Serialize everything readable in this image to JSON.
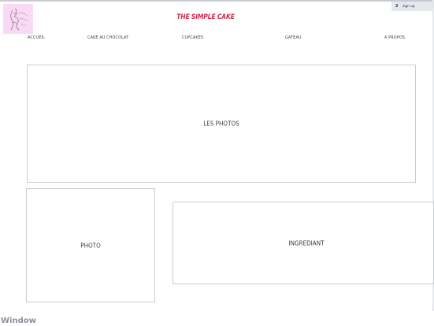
{
  "header": {
    "title": "THE SIMPLE CAKE",
    "logo": {
      "icon": "cake-logo-icon",
      "background": "#f9d9f3"
    },
    "signup": {
      "count": "2",
      "label": "sign up"
    }
  },
  "nav": {
    "items": [
      "ACCUEIL",
      "CAKE AU CHOCOLAT",
      "CUPCAKES",
      "GATEAU",
      "A PROPOS"
    ]
  },
  "main": {
    "photos_label": "LES PHOTOS",
    "photo_label": "PHOTO",
    "ingredient_label": "INGREDIANT"
  },
  "footer": {
    "window_label": "Window"
  },
  "colors": {
    "brand": "#cf2b4c",
    "border": "#c9cdd2",
    "text": "#353b45",
    "muted": "#8a909a"
  }
}
